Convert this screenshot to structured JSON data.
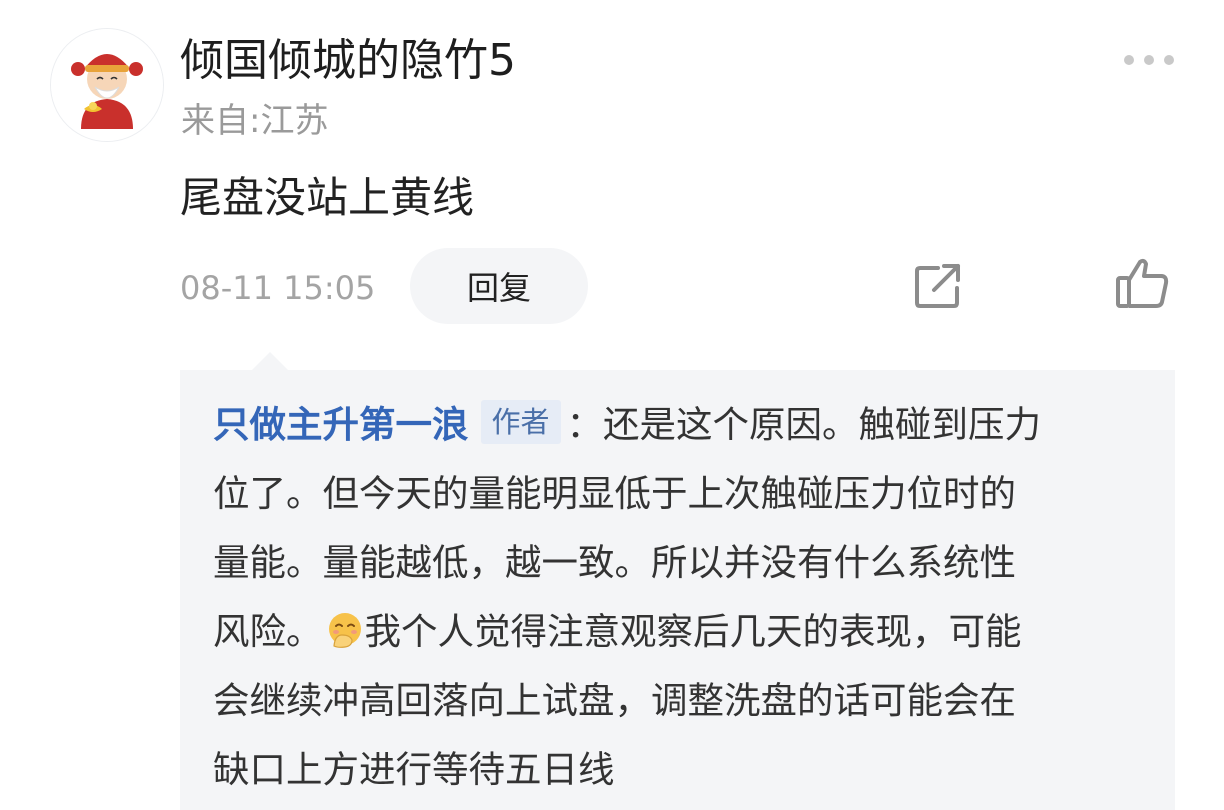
{
  "comment": {
    "username": "倾国倾城的隐竹5",
    "location": "来自:江苏",
    "text": "尾盘没站上黄线",
    "timestamp": "08-11 15:05",
    "reply_button_label": "回复",
    "icons": {
      "more": "more-dots-icon",
      "share": "share-icon",
      "like": "thumbs-up-icon"
    }
  },
  "reply": {
    "author": "只做主升第一浪",
    "author_badge": "作者",
    "lines": [
      "：还是这个原因。触碰到压力",
      "位了。但今天的量能明显低于上次触碰压力位时的",
      "量能。量能越低，越一致。所以并没有什么系统性",
      "风险。",
      "我个人觉得注意观察后几天的表现，可能",
      "会继续冲高回落向上试盘，调整洗盘的话可能会在",
      "缺口上方进行等待五日线"
    ],
    "emoji": "smiling-face-with-hand-over-mouth-icon"
  },
  "colors": {
    "author_link": "#3466b8",
    "badge_bg": "#e6ecf6",
    "reply_bg": "#f4f5f7",
    "secondary_text": "#9a9a9a"
  }
}
